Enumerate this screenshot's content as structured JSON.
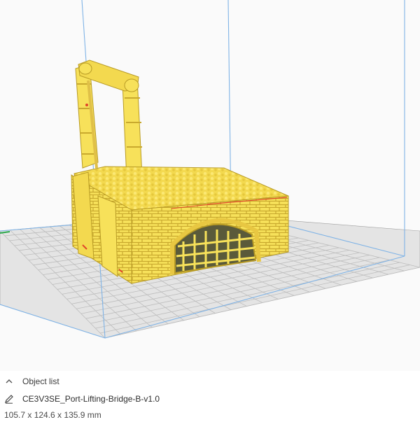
{
  "viewport": {
    "colors": {
      "background": "#fafafa",
      "grid_line": "#bdbdbd",
      "plate": "#e4e4e4",
      "volume_edge": "#7fb3e6",
      "model": "#f7e15a",
      "model_shadow": "#d8b93a",
      "model_outline": "#b89b25",
      "overhang": "#e0452a"
    }
  },
  "object_panel": {
    "header_label": "Object list",
    "header_icon": "chevron-up-icon",
    "object_name": "CE3V3SE_Port-Lifting-Bridge-B-v1.0",
    "object_icon": "pencil-icon",
    "dimensions": "105.7 x 124.6 x 135.9 mm"
  }
}
